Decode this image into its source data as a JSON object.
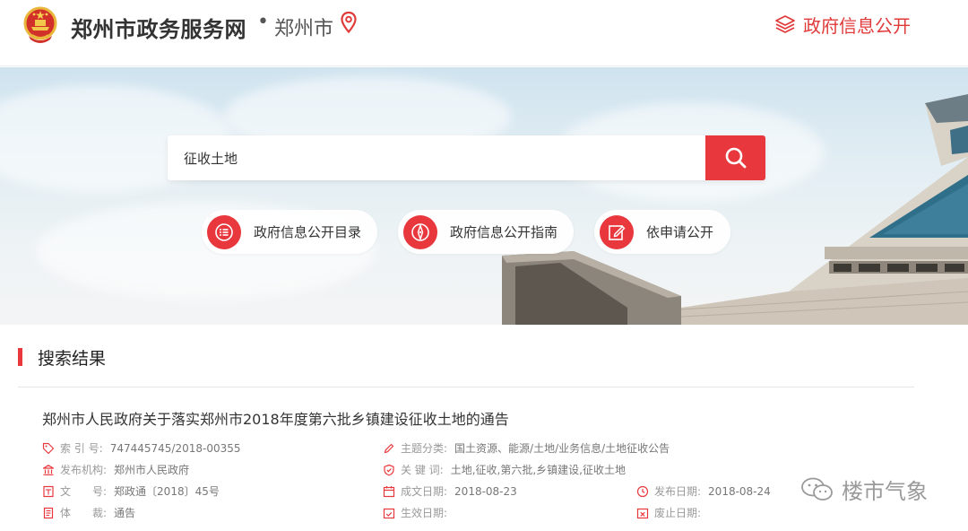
{
  "header": {
    "site_title": "郑州市政务服务网",
    "separator": "•",
    "city": "郑州市",
    "gov_info_link": "政府信息公开"
  },
  "search": {
    "value": "征收土地",
    "button_icon": "search-icon"
  },
  "quick_links": [
    {
      "label": "政府信息公开目录",
      "icon": "list-icon"
    },
    {
      "label": "政府信息公开指南",
      "icon": "compass-icon"
    },
    {
      "label": "依申请公开",
      "icon": "edit-icon"
    }
  ],
  "results": {
    "heading": "搜索结果",
    "items": [
      {
        "title": "郑州市人民政府关于落实郑州市2018年度第六批乡镇建设征收土地的通告",
        "meta": {
          "index_key": "索 引 号:",
          "index_value": "747445745/2018-00355",
          "category_key": "主题分类:",
          "category_value": "国土资源、能源/土地/业务信息/土地征收公告",
          "org_key": "发布机构:",
          "org_value": "郑州市人民政府",
          "keywords_key": "关 键 词:",
          "keywords_value": "土地,征收,第六批,乡镇建设,征收土地",
          "doc_no_key": "文　　号:",
          "doc_no_value": "郑政通〔2018〕45号",
          "written_date_key": "成文日期:",
          "written_date_value": "2018-08-23",
          "publish_date_key": "发布日期:",
          "publish_date_value": "2018-08-24",
          "genre_key": "体　　裁:",
          "genre_value": "通告",
          "effective_date_key": "生效日期:",
          "effective_date_value": "",
          "expiry_date_key": "废止日期:",
          "expiry_date_value": ""
        }
      }
    ]
  },
  "watermark": {
    "text": "楼市气象",
    "icon": "wechat-icon"
  },
  "colors": {
    "accent": "#e8383d",
    "text": "#333333",
    "muted": "#999999"
  }
}
